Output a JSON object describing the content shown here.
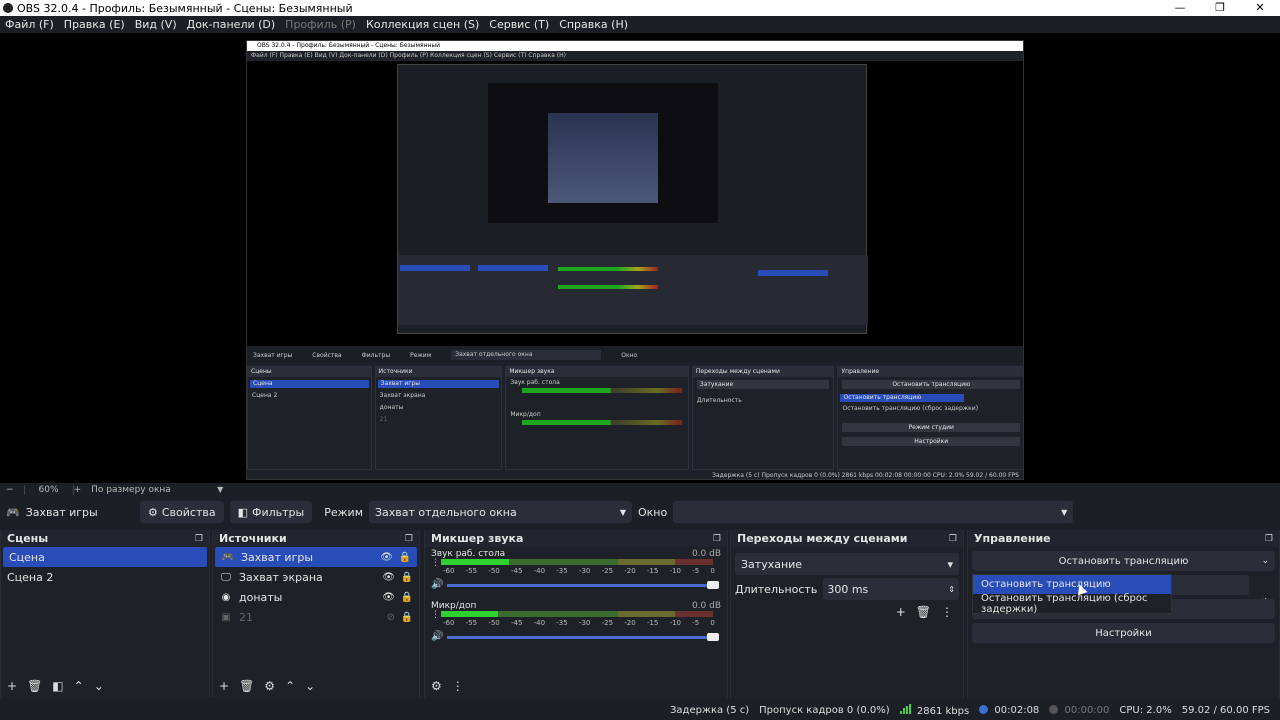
{
  "window": {
    "title": "OBS 32.0.4 - Профиль: Безымянный - Сцены: Безымянный",
    "min": "—",
    "max": "❐",
    "close": "✕"
  },
  "menu": [
    {
      "label": "Файл (F)",
      "enabled": true
    },
    {
      "label": "Правка (E)",
      "enabled": true
    },
    {
      "label": "Вид (V)",
      "enabled": true
    },
    {
      "label": "Док-панели (D)",
      "enabled": true
    },
    {
      "label": "Профиль (P)",
      "enabled": false
    },
    {
      "label": "Коллекция сцен (S)",
      "enabled": true
    },
    {
      "label": "Сервис (T)",
      "enabled": true
    },
    {
      "label": "Справка (H)",
      "enabled": true
    }
  ],
  "zoom": {
    "value": "60%",
    "mode": "По размеру окна"
  },
  "source_toolbar": {
    "source_name": "Захват игры",
    "properties": "Свойства",
    "filters": "Фильтры",
    "mode_label": "Режим",
    "mode_value": "Захват отдельного окна",
    "window_label": "Окно",
    "window_value": ""
  },
  "scenes": {
    "title": "Сцены",
    "items": [
      {
        "label": "Сцена",
        "selected": true
      },
      {
        "label": "Сцена 2",
        "selected": false
      }
    ]
  },
  "sources": {
    "title": "Источники",
    "items": [
      {
        "label": "Захват игры",
        "icon": "gamepad-icon",
        "selected": true
      },
      {
        "label": "Захват экрана",
        "icon": "monitor-icon",
        "selected": false
      },
      {
        "label": "донаты",
        "icon": "browser-icon",
        "selected": false
      },
      {
        "label": "21",
        "icon": "image-icon",
        "selected": false,
        "hidden": true
      }
    ]
  },
  "mixer": {
    "title": "Микшер звука",
    "scale": [
      "-60",
      "-55",
      "-50",
      "-45",
      "-40",
      "-35",
      "-30",
      "-25",
      "-20",
      "-15",
      "-10",
      "-5",
      "0"
    ],
    "channels": [
      {
        "name": "Звук раб. стола",
        "db": "0.0 dB",
        "level": 0.25,
        "volume": 1.0
      },
      {
        "name": "Микр/доп",
        "db": "0.0 dB",
        "level": 0.21,
        "volume": 1.0
      }
    ]
  },
  "transitions": {
    "title": "Переходы между сценами",
    "type": "Затухание",
    "duration_label": "Длительность",
    "duration_value": "300 ms"
  },
  "controls": {
    "title": "Управление",
    "stop_stream": "Остановить трансляцию",
    "studio_mode": "Режим студии",
    "settings": "Настройки",
    "menu_items": [
      "Остановить трансляцию",
      "Остановить трансляцию (сброс задержки)"
    ]
  },
  "status": {
    "delay": "Задержка (5 с)",
    "dropped": "Пропуск кадров 0 (0.0%)",
    "bitrate": "2861 kbps",
    "stream_time": "00:02:08",
    "rec_time": "00:00:00",
    "cpu": "CPU: 2.0%",
    "fps": "59.02 / 60.00 FPS"
  },
  "colors": {
    "accent": "#284cb8",
    "bg": "#1d1f26",
    "live": "#2fd12f"
  },
  "nested_preview": {
    "title": "OBS 32.0.4 - Профиль: Безымянный - Сцены: Безымянный",
    "menu": "Файл (F)   Правка (E)   Вид (V)   Док-панели (D)   Профиль (P)   Коллекция сцен (S)   Сервис (T)   Справка (H)",
    "toolbar_src": "Захват игры",
    "toolbar_props": "Свойства",
    "toolbar_filters": "Фильтры",
    "toolbar_mode": "Режим",
    "toolbar_mode_value": "Захват отдельного окна",
    "toolbar_window": "Окно",
    "status": "Задержка (5 с)   Пропуск кадров 0 (0.0%)   2861 kbps   00:02:08   00:00:00   CPU: 2.0%   59.02 / 60.00 FPS"
  }
}
